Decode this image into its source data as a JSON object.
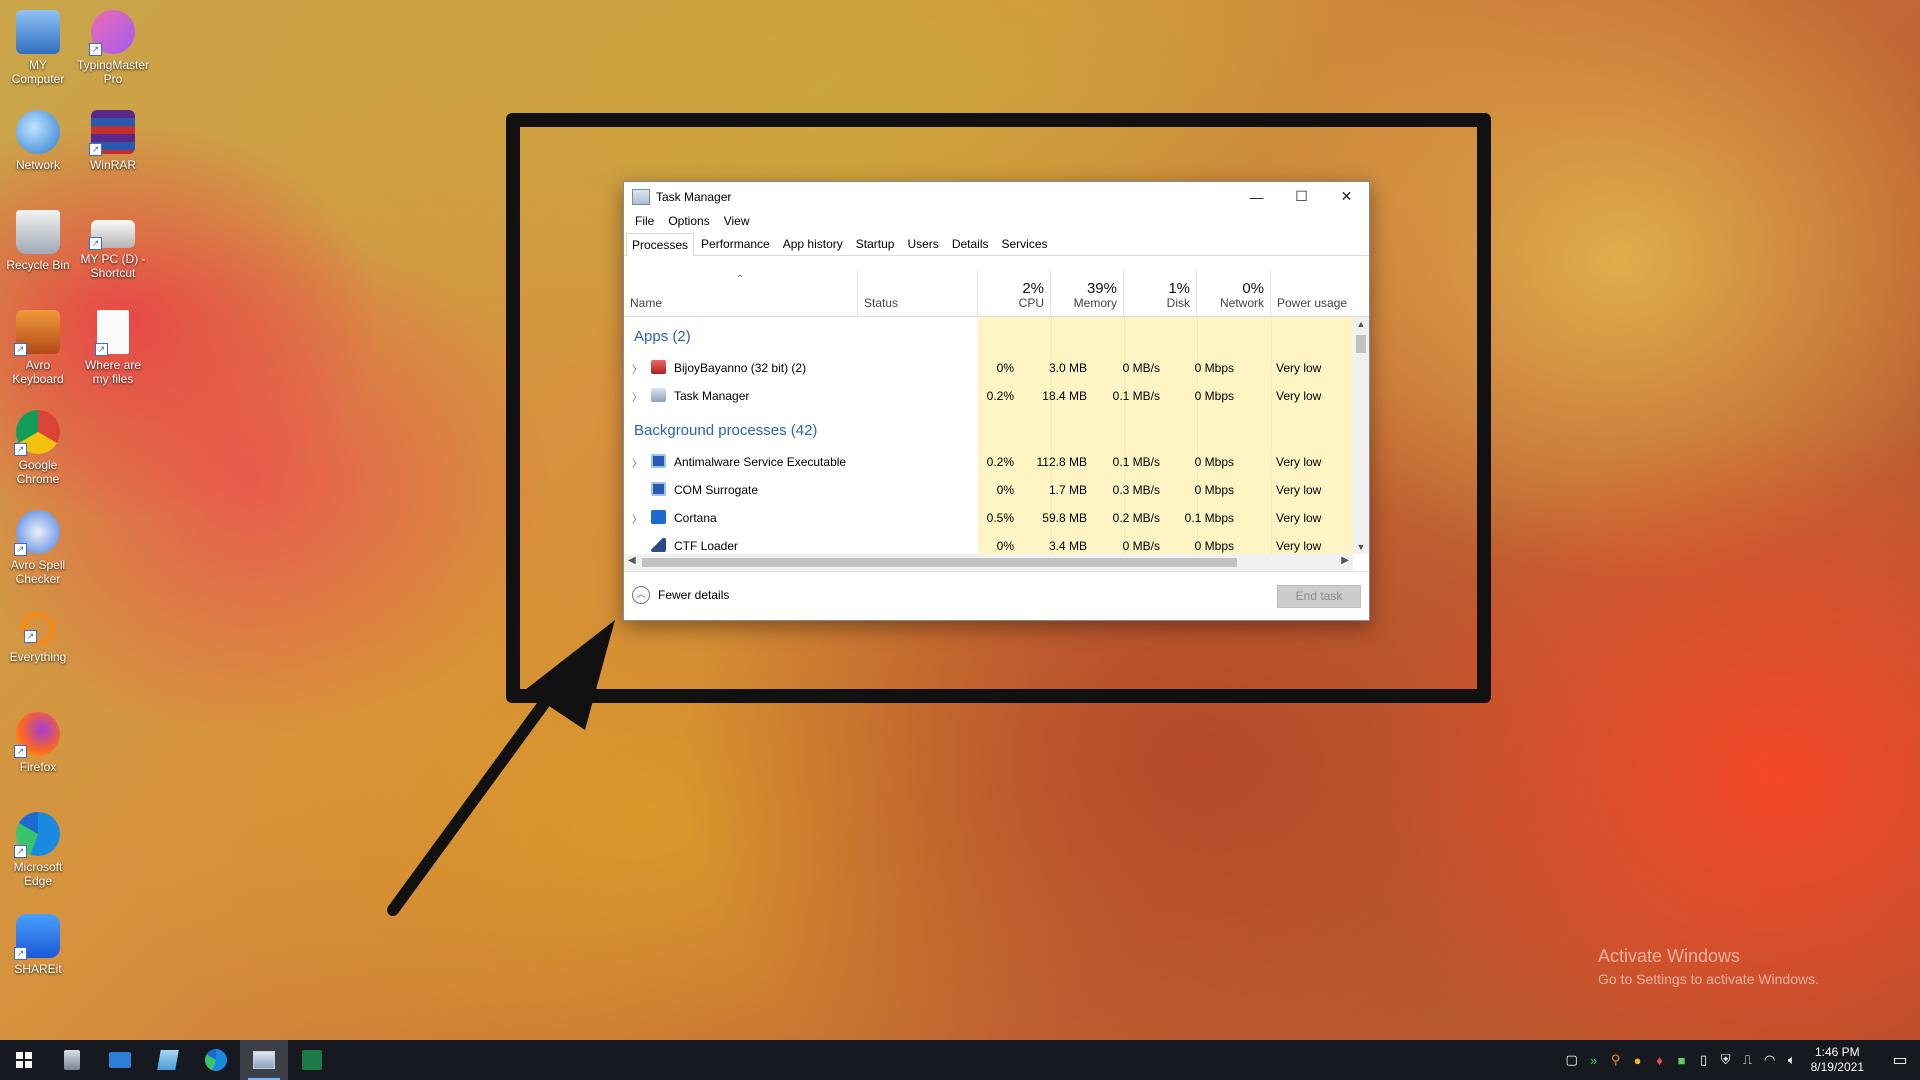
{
  "desktop": {
    "icons": [
      {
        "label": "MY Computer"
      },
      {
        "label": "TypingMaster Pro"
      },
      {
        "label": "Network"
      },
      {
        "label": "WinRAR"
      },
      {
        "label": "Recycle Bin"
      },
      {
        "label": "MY PC (D) - Shortcut"
      },
      {
        "label": "Avro Keyboard"
      },
      {
        "label": "Where are my files"
      },
      {
        "label": "Google Chrome"
      },
      {
        "label": "Avro Spell Checker"
      },
      {
        "label": "Everything"
      },
      {
        "label": "Firefox"
      },
      {
        "label": "Microsoft Edge"
      },
      {
        "label": "SHAREit"
      }
    ]
  },
  "task_manager": {
    "title": "Task Manager",
    "window_buttons": {
      "minimize": "—",
      "maximize": "☐",
      "close": "✕"
    },
    "menu": [
      "File",
      "Options",
      "View"
    ],
    "tabs": [
      "Processes",
      "Performance",
      "App history",
      "Startup",
      "Users",
      "Details",
      "Services"
    ],
    "active_tab": "Processes",
    "columns": {
      "name": "Name",
      "status": "Status",
      "cpu": {
        "pct": "2%",
        "label": "CPU"
      },
      "memory": {
        "pct": "39%",
        "label": "Memory"
      },
      "disk": {
        "pct": "1%",
        "label": "Disk"
      },
      "network": {
        "pct": "0%",
        "label": "Network"
      },
      "power": "Power usage"
    },
    "groups": {
      "apps": "Apps (2)",
      "background": "Background processes (42)"
    },
    "apps": [
      {
        "name": "BijoyBayanno (32 bit) (2)",
        "cpu": "0%",
        "memory": "3.0 MB",
        "disk": "0 MB/s",
        "network": "0 Mbps",
        "power": "Very low"
      },
      {
        "name": "Task Manager",
        "cpu": "0.2%",
        "memory": "18.4 MB",
        "disk": "0.1 MB/s",
        "network": "0 Mbps",
        "power": "Very low"
      }
    ],
    "background": [
      {
        "name": "Antimalware Service Executable",
        "cpu": "0.2%",
        "memory": "112.8 MB",
        "disk": "0.1 MB/s",
        "network": "0 Mbps",
        "power": "Very low"
      },
      {
        "name": "COM Surrogate",
        "cpu": "0%",
        "memory": "1.7 MB",
        "disk": "0.3 MB/s",
        "network": "0 Mbps",
        "power": "Very low"
      },
      {
        "name": "Cortana",
        "cpu": "0.5%",
        "memory": "59.8 MB",
        "disk": "0.2 MB/s",
        "network": "0.1 Mbps",
        "power": "Very low"
      },
      {
        "name": "CTF Loader",
        "cpu": "0%",
        "memory": "3.4 MB",
        "disk": "0 MB/s",
        "network": "0 Mbps",
        "power": "Very low"
      }
    ],
    "footer": {
      "fewer_details": "Fewer details",
      "end_task": "End task"
    }
  },
  "watermark": {
    "line1": "Activate Windows",
    "line2": "Go to Settings to activate Windows."
  },
  "taskbar": {
    "time": "1:46 PM",
    "date": "8/19/2021"
  }
}
